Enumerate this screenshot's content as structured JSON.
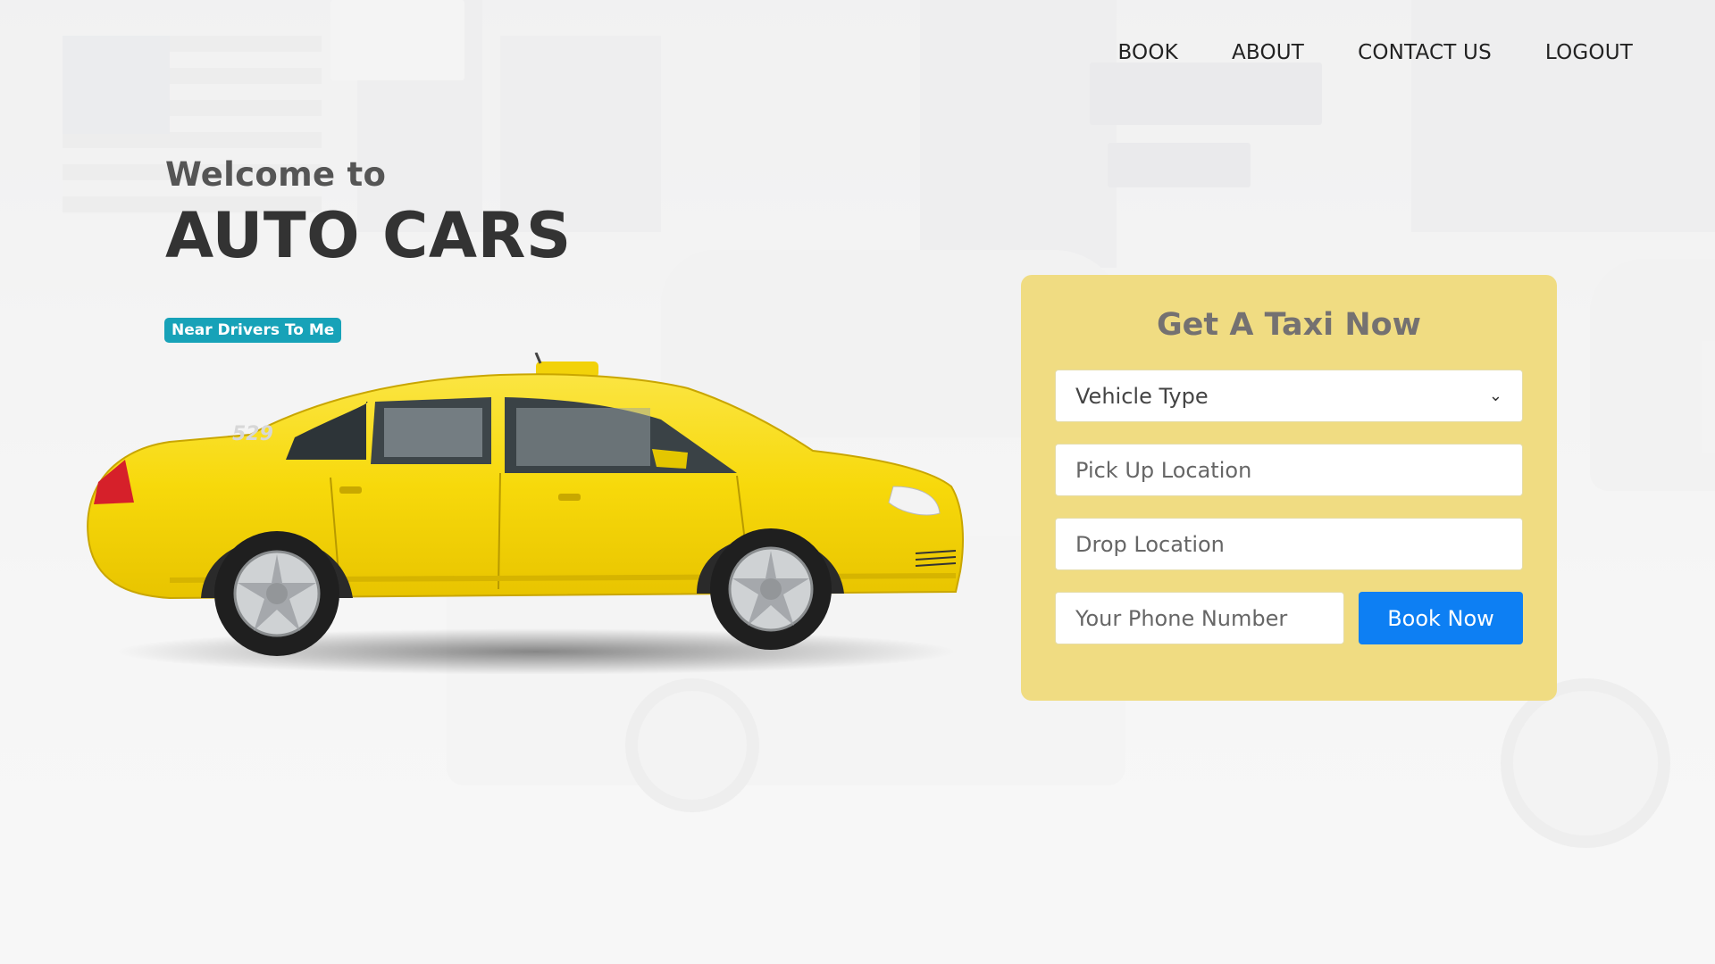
{
  "nav": {
    "items": [
      {
        "label": "BOOK"
      },
      {
        "label": "ABOUT"
      },
      {
        "label": "CONTACT US"
      },
      {
        "label": "LOGOUT"
      }
    ]
  },
  "hero": {
    "welcome": "Welcome to",
    "brand": "AUTO CARS",
    "badge": "Near Drivers To Me"
  },
  "taxi": {
    "number_plate_text": "529"
  },
  "booking": {
    "title": "Get A Taxi Now",
    "vehicle_type": "Vehicle Type",
    "pickup_placeholder": "Pick Up Location",
    "drop_placeholder": "Drop Location",
    "phone_placeholder": "Your Phone Number",
    "submit_label": "Book Now"
  },
  "colors": {
    "card_bg": "#f0dc82",
    "badge_bg": "#17a2b8",
    "button_bg": "#0d7ff3",
    "taxi_yellow": "#f7d90b"
  }
}
